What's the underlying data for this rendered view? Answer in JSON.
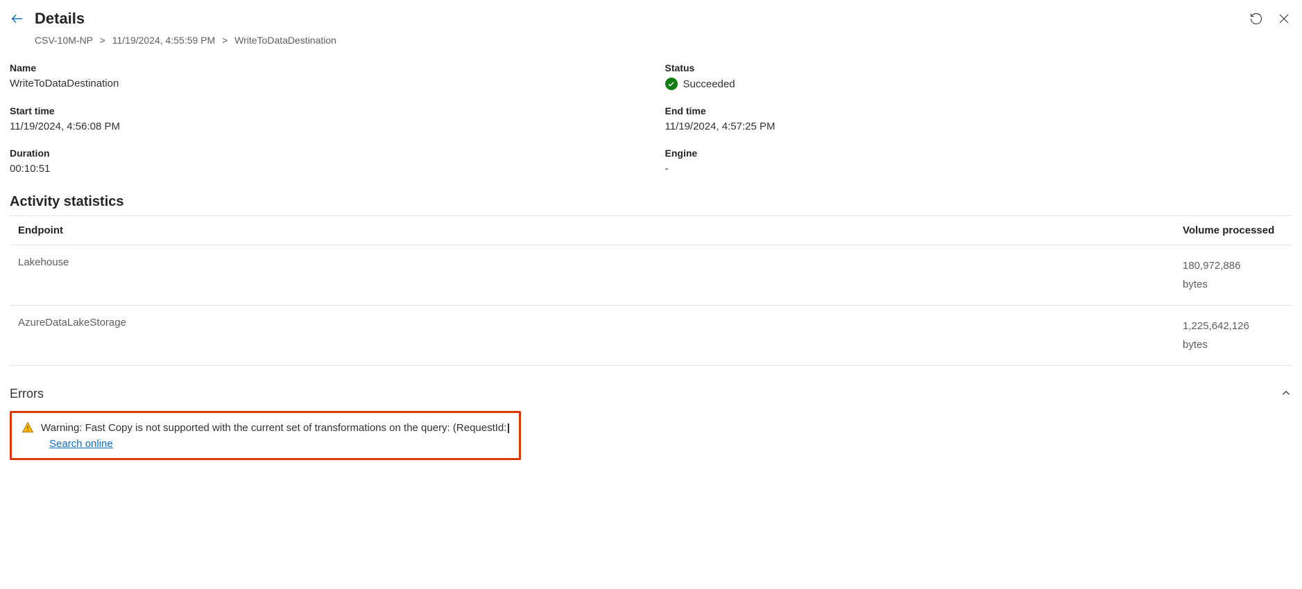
{
  "header": {
    "title": "Details"
  },
  "breadcrumb": {
    "items": [
      "CSV-10M-NP",
      "11/19/2024, 4:55:59 PM",
      "WriteToDataDestination"
    ]
  },
  "fields": {
    "name_label": "Name",
    "name_value": "WriteToDataDestination",
    "status_label": "Status",
    "status_value": "Succeeded",
    "start_label": "Start time",
    "start_value": "11/19/2024, 4:56:08 PM",
    "end_label": "End time",
    "end_value": "11/19/2024, 4:57:25 PM",
    "duration_label": "Duration",
    "duration_value": "00:10:51",
    "engine_label": "Engine",
    "engine_value": "-"
  },
  "stats": {
    "title": "Activity statistics",
    "cols": [
      "Endpoint",
      "Volume processed"
    ],
    "rows": [
      {
        "endpoint": "Lakehouse",
        "volume_num": "180,972,886",
        "volume_unit": "bytes"
      },
      {
        "endpoint": "AzureDataLakeStorage",
        "volume_num": "1,225,642,126",
        "volume_unit": "bytes"
      }
    ]
  },
  "errors": {
    "title": "Errors",
    "message": "Warning: Fast Copy is not supported with the current set of transformations on the query: (RequestId:",
    "search_link": "Search online"
  }
}
